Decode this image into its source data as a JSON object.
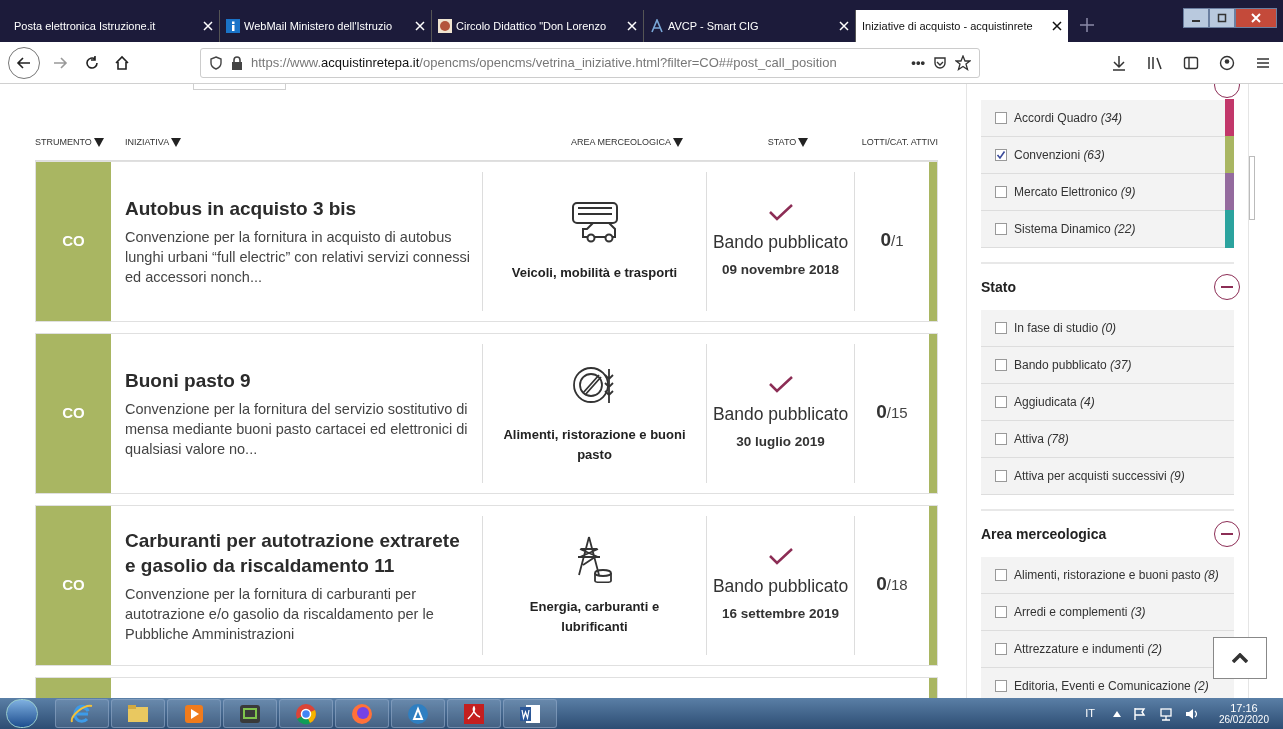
{
  "browser": {
    "tabs": [
      {
        "title": "Posta elettronica Istruzione.it",
        "selected": false
      },
      {
        "title": "WebMail Ministero dell'Istruzio",
        "selected": false
      },
      {
        "title": "Circolo Didattico \"Don Lorenzo",
        "selected": false
      },
      {
        "title": "AVCP - Smart CIG",
        "selected": false
      },
      {
        "title": "Iniziative di acquisto - acquistinrete",
        "selected": true
      }
    ],
    "url_prefix": "https://www.",
    "url_domain": "acquistinretepa.it",
    "url_rest": "/opencms/opencms/vetrina_iniziative.html?filter=CO##post_call_position",
    "page_actions": "•••"
  },
  "table": {
    "columns": [
      {
        "label": "STRUMENTO",
        "sortable": true
      },
      {
        "label": "INIZIATIVA",
        "sortable": true
      },
      {
        "label": "AREA MERCEOLOGICA",
        "sortable": true
      },
      {
        "label": "STATO",
        "sortable": true
      },
      {
        "label": "LOTTI/CAT. ATTIVI",
        "sortable": false
      }
    ],
    "rows": [
      {
        "tool": "CO",
        "title": "Autobus in acquisto 3 bis",
        "description": "Convenzione per la fornitura in acquisto di autobus lunghi urbani “full electric” con relativi servizi connessi ed accessori nonch...",
        "kind": "vehicles",
        "area": "Veicoli, mobilità e trasporti",
        "status": "Bando pubblicato",
        "date": "09 novembre 2018",
        "active": "0",
        "total": "/1"
      },
      {
        "tool": "CO",
        "title": "Buoni pasto 9",
        "description": "Convenzione per la fornitura del servizio sostitutivo di mensa mediante buoni pasto cartacei ed elettronici di qualsiasi valore no...",
        "kind": "food",
        "area": "Alimenti, ristorazione e buoni pasto",
        "status": "Bando pubblicato",
        "date": "30 luglio 2019",
        "active": "0",
        "total": "/15"
      },
      {
        "tool": "CO",
        "title": "Carburanti per autotrazione extrarete e gasolio da riscaldamento 11",
        "description": "Convenzione per la fornitura di carburanti per autotrazione e/o gasolio da riscaldamento per le Pubbliche Amministrazioni",
        "kind": "energy",
        "area": "Energia, carburanti e lubrificanti",
        "status": "Bando pubblicato",
        "date": "16 settembre 2019",
        "active": "0",
        "total": "/18"
      }
    ],
    "next_row_partial": true
  },
  "sidebar": {
    "groups": [
      {
        "items": [
          {
            "label": "Accordi Quadro *(34)*",
            "checked": false,
            "color": "#c2376a"
          },
          {
            "label": "Convenzioni *(63)*",
            "checked": true,
            "color": "#a9b662"
          },
          {
            "label": "Mercato Elettronico *(9)*",
            "checked": false,
            "color": "#946b9e"
          },
          {
            "label": "Sistema Dinamico *(22)*",
            "checked": false,
            "color": "#2ba39e"
          }
        ]
      },
      {
        "title": "Stato",
        "expanded": true,
        "items": [
          {
            "label": "In fase di studio *(0)*",
            "checked": false
          },
          {
            "label": "Bando pubblicato *(37)*",
            "checked": false
          },
          {
            "label": "Aggiudicata *(4)*",
            "checked": false
          },
          {
            "label": "Attiva *(78)*",
            "checked": false
          },
          {
            "label": "Attiva per acquisti successivi *(9)*",
            "checked": false
          }
        ]
      },
      {
        "title": "Area merceologica",
        "expanded": true,
        "items": [
          {
            "label": "Alimenti, ristorazione e buoni pasto *(8)*",
            "checked": false
          },
          {
            "label": "Arredi e complementi *(3)*",
            "checked": false
          },
          {
            "label": "Attrezzature e indumenti *(2)*",
            "checked": false
          },
          {
            "label": "Editoria, Eventi e Comunicazione *(2)*",
            "checked": false
          }
        ]
      }
    ]
  },
  "taskbar": {
    "apps": [
      {
        "kind": "ie"
      },
      {
        "kind": "folder"
      },
      {
        "kind": "media"
      },
      {
        "kind": "remote"
      },
      {
        "kind": "chrome"
      },
      {
        "kind": "firefox"
      },
      {
        "kind": "delta"
      },
      {
        "kind": "pdf"
      },
      {
        "kind": "word"
      }
    ],
    "language": "IT",
    "time": "17:16",
    "date": "26/02/2020"
  }
}
